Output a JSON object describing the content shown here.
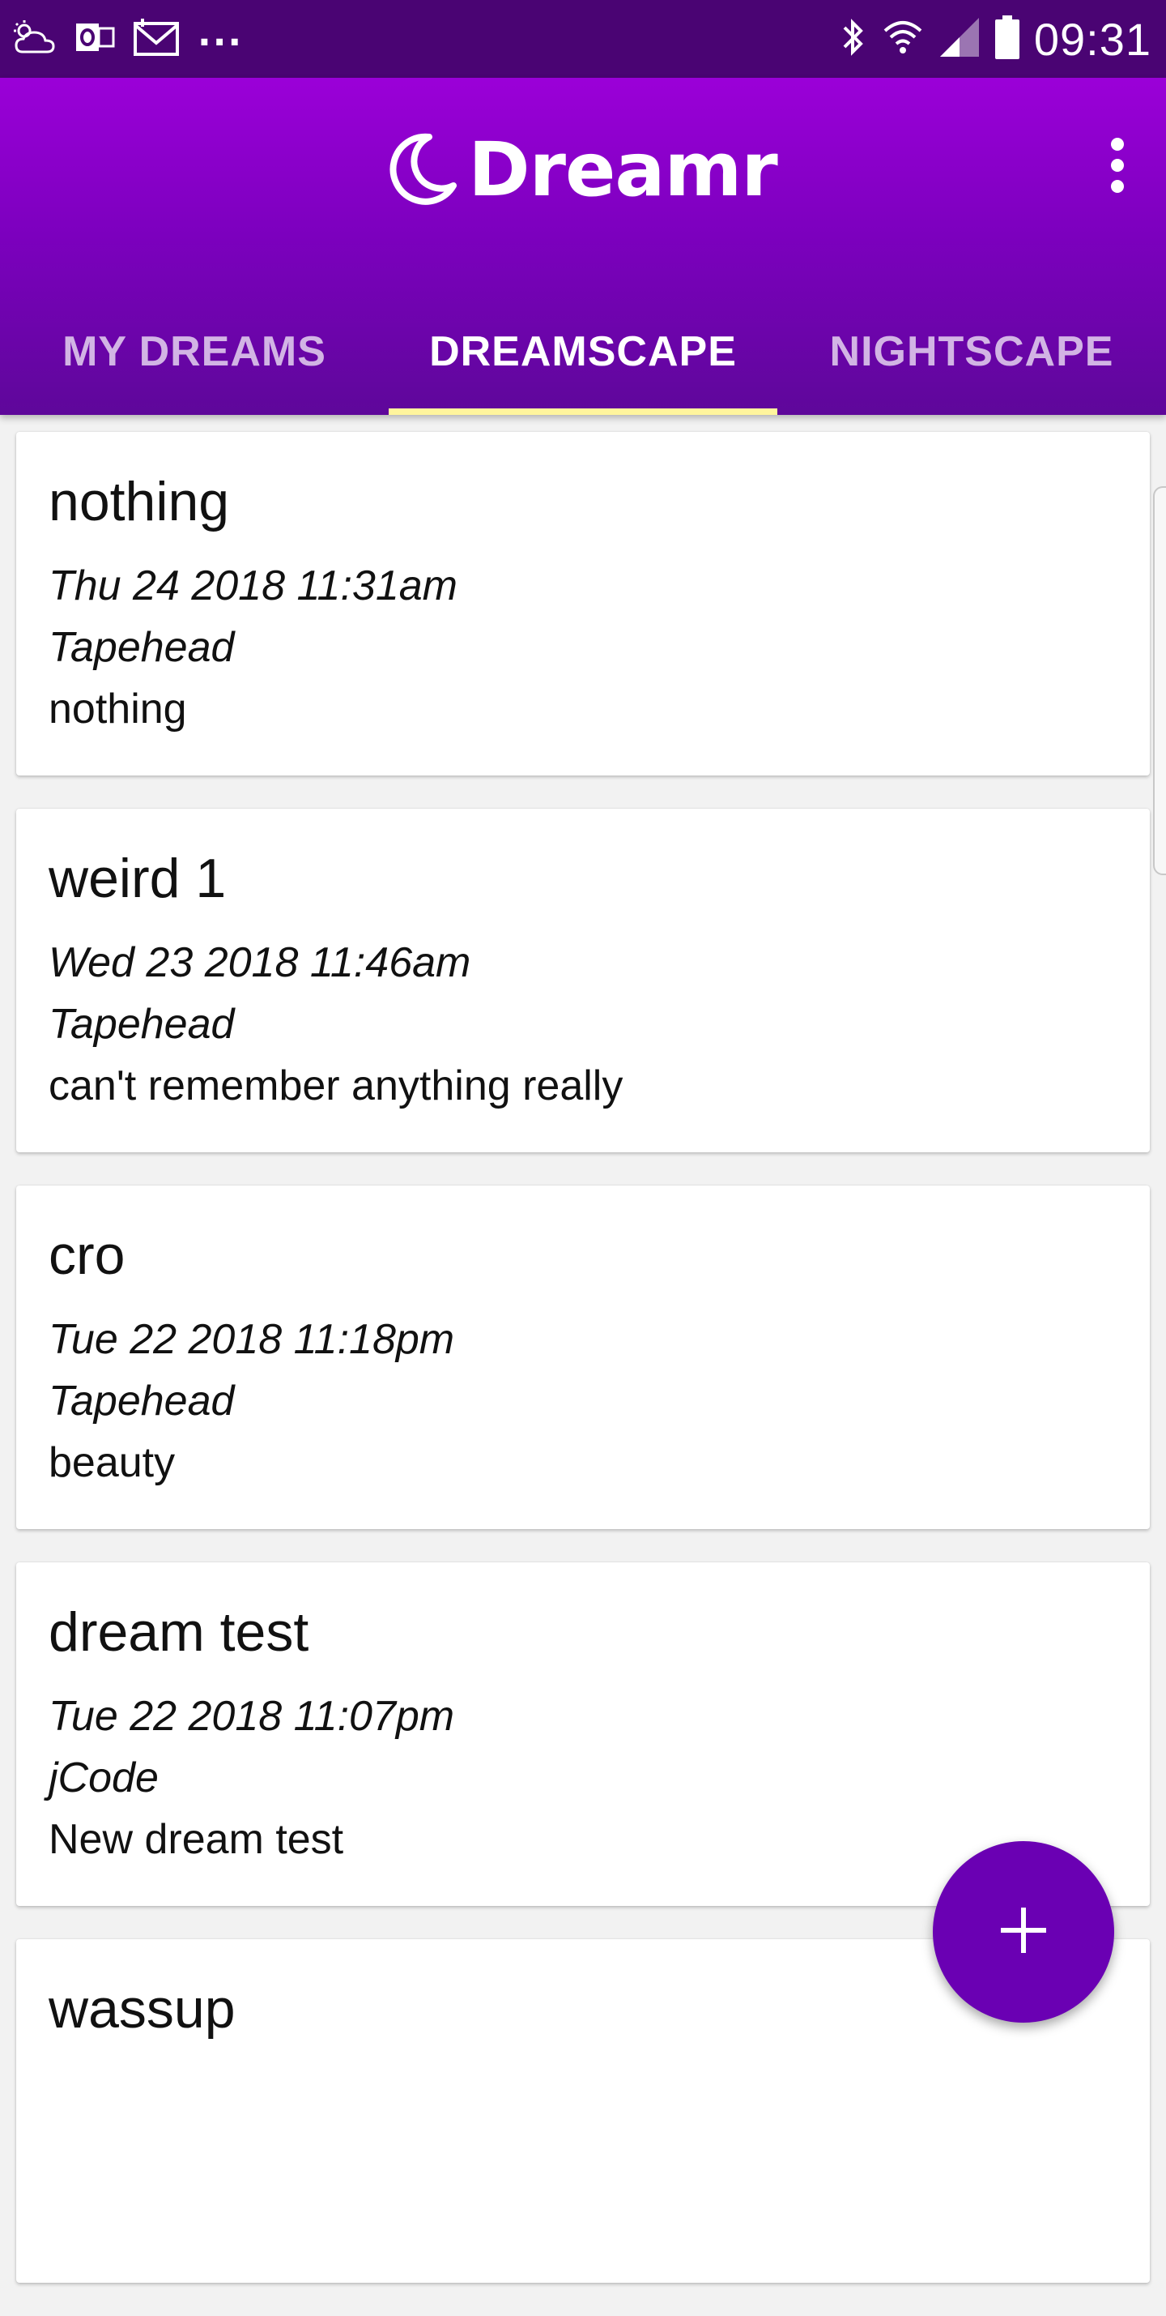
{
  "status_bar": {
    "time": "09:31",
    "more": "...",
    "left_icons": [
      "weather-cloud-icon",
      "outlook-icon",
      "mail-icon"
    ],
    "right_icons": [
      "bluetooth-icon",
      "wifi-icon",
      "signal-icon",
      "battery-icon"
    ]
  },
  "app_bar": {
    "title": "Dreamr",
    "logo_icon": "moon-icon",
    "menu_icon": "more-vert-icon"
  },
  "tabs": [
    {
      "label": "MY DREAMS",
      "active": false
    },
    {
      "label": "DREAMSCAPE",
      "active": true
    },
    {
      "label": "NIGHTSCAPE",
      "active": false
    }
  ],
  "dreams": [
    {
      "title": "nothing",
      "date": "Thu 24 2018 11:31am",
      "author": "Tapehead",
      "text": "nothing"
    },
    {
      "title": "weird 1",
      "date": "Wed 23 2018 11:46am",
      "author": "Tapehead",
      "text": "can't remember anything really"
    },
    {
      "title": "cro",
      "date": "Tue 22 2018 11:18pm",
      "author": "Tapehead",
      "text": "beauty"
    },
    {
      "title": "dream test",
      "date": "Tue 22 2018 11:07pm",
      "author": "jCode",
      "text": "New dream test"
    },
    {
      "title": "wassup",
      "date": "",
      "author": "",
      "text": ""
    }
  ],
  "fab": {
    "icon": "plus-icon"
  },
  "colors": {
    "status_bar": "#4a0473",
    "app_bar_top": "#9b00d8",
    "app_bar_bottom": "#5e079a",
    "tab_indicator": "#fff59d",
    "fab": "#6a00b3"
  }
}
